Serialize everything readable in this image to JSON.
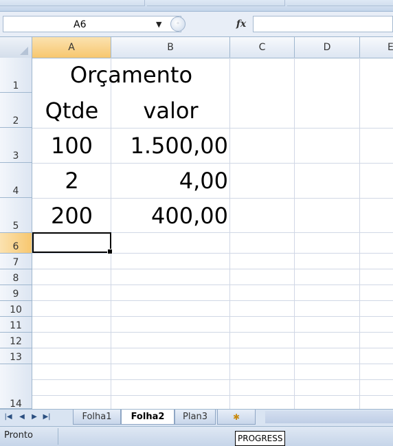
{
  "name_box": {
    "value": "A6"
  },
  "formula_bar": {
    "fx_label": "fx",
    "value": ""
  },
  "columns": [
    "A",
    "B",
    "C",
    "D",
    "E"
  ],
  "rows": [
    "1",
    "2",
    "3",
    "4",
    "5",
    "6",
    "7",
    "8",
    "9",
    "10",
    "11",
    "12",
    "13",
    "14"
  ],
  "cells": {
    "A1": "Orçamento",
    "A2": "Qtde",
    "B2": "valor",
    "A3": "100",
    "B3": "1.500,00",
    "A4": "2",
    "B4": "4,00",
    "A5": "200",
    "B5": "400,00"
  },
  "selected_cell": "A6",
  "sheet_tabs": [
    {
      "label": "Folha1",
      "active": false
    },
    {
      "label": "Folha2",
      "active": true
    },
    {
      "label": "Plan3",
      "active": false
    }
  ],
  "status": {
    "ready_text": "Pronto"
  },
  "tooltip": {
    "text": "PROGRESS"
  },
  "colors": {
    "selected_header": "#f7c76f",
    "gridline": "#d0d7e5",
    "header_border": "#9eb6ce"
  }
}
